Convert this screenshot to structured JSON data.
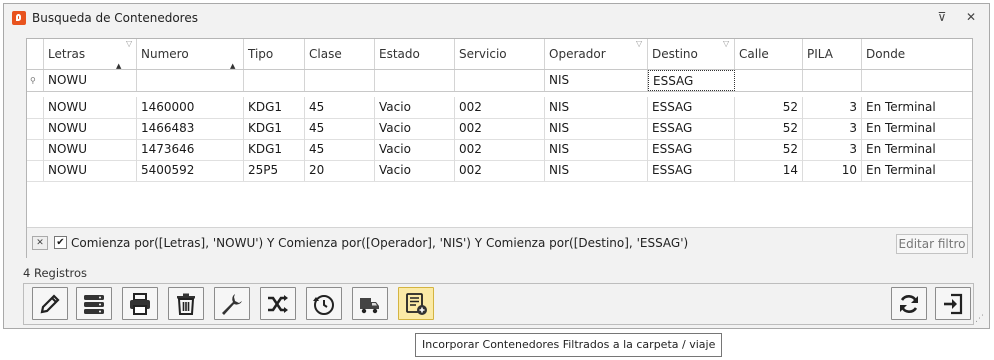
{
  "window": {
    "title": "Busqueda de Contenedores",
    "pin_glyph": "⊽",
    "close_glyph": "✕"
  },
  "grid": {
    "columns": [
      "Letras",
      "Numero",
      "Tipo",
      "Clase",
      "Estado",
      "Servicio",
      "Operador",
      "Destino",
      "Calle",
      "PILA",
      "Donde"
    ],
    "filter_values": {
      "letras": "NOWU",
      "operador": "NIS",
      "destino": "ESSAG"
    },
    "rows": [
      [
        "NOWU",
        "1460000",
        "KDG1",
        "45",
        "Vacio",
        "002",
        "NIS",
        "ESSAG",
        "52",
        "3",
        "En Terminal"
      ],
      [
        "NOWU",
        "1466483",
        "KDG1",
        "45",
        "Vacio",
        "002",
        "NIS",
        "ESSAG",
        "52",
        "3",
        "En Terminal"
      ],
      [
        "NOWU",
        "1473646",
        "KDG1",
        "45",
        "Vacio",
        "002",
        "NIS",
        "ESSAG",
        "52",
        "3",
        "En Terminal"
      ],
      [
        "NOWU",
        "5400592",
        "25P5",
        "20",
        "Vacio",
        "002",
        "NIS",
        "ESSAG",
        "14",
        "10",
        "En Terminal"
      ]
    ],
    "filter_expression": "Comienza por([Letras], 'NOWU') Y Comienza por([Operador], 'NIS') Y Comienza por([Destino], 'ESSAG')",
    "edit_filter_label": "Editar filtro",
    "filter_enabled": true
  },
  "record_count": "4 Registros",
  "toolbar": {
    "buttons": [
      "edit-icon",
      "server-icon",
      "print-icon",
      "trash-icon",
      "wrench-icon",
      "shuffle-icon",
      "history-icon",
      "truck-icon",
      "add-list-icon"
    ],
    "right_buttons": [
      "refresh-icon",
      "exit-icon"
    ],
    "active_button": "add-list-icon"
  },
  "tooltip": "Incorporar Contenedores Filtrados a la carpeta / viaje"
}
